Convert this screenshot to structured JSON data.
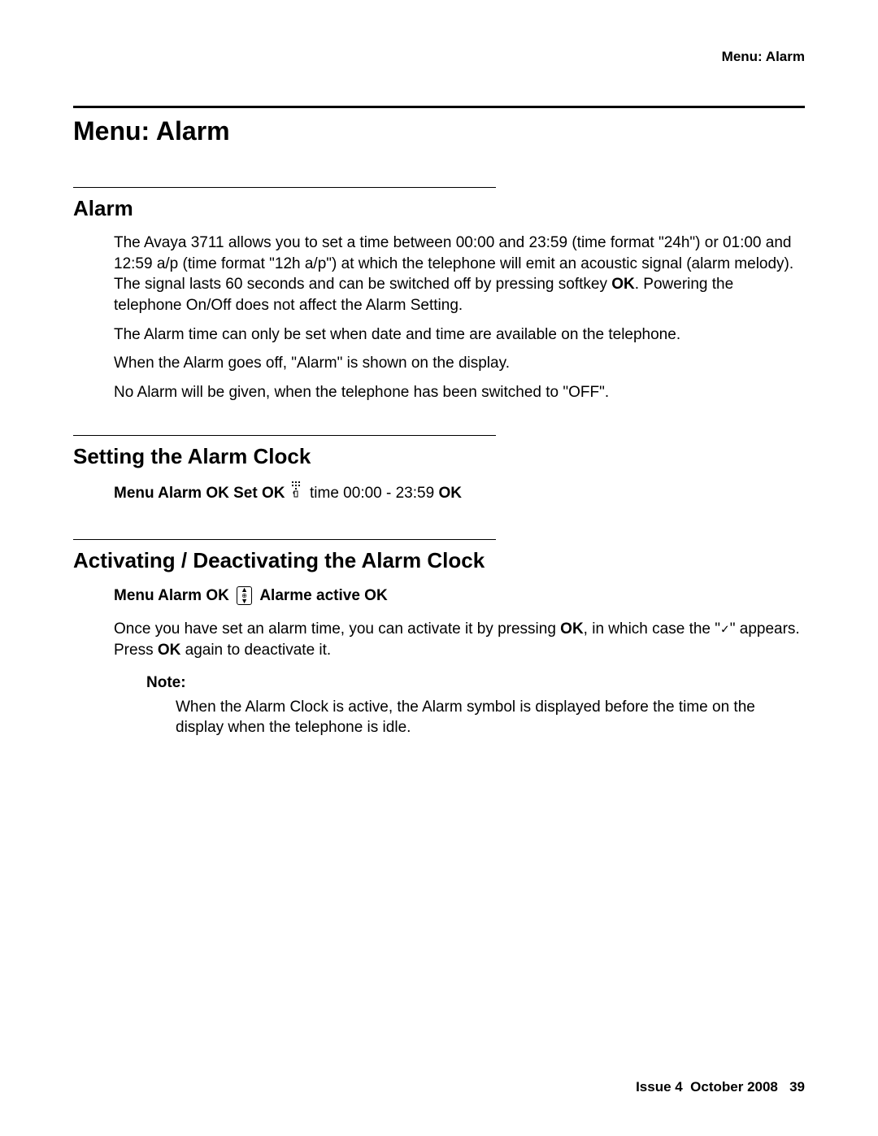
{
  "header": {
    "running": "Menu: Alarm"
  },
  "title": "Menu: Alarm",
  "sections": {
    "alarm": {
      "heading": "Alarm",
      "p1a": "The Avaya 3711 allows you to set a time between 00:00 and 23:59 (time format \"24h\") or 01:00 and 12:59 a/p (time format \"12h a/p\") at which the telephone will emit an acoustic signal (alarm melody). The signal lasts 60 seconds and can be switched off by pressing softkey ",
      "p1b": "OK",
      "p1c": ". Powering the telephone On/Off does not affect the Alarm Setting.",
      "p2": "The Alarm time can only be set when date and time are available on the telephone.",
      "p3": "When the Alarm goes off, \"Alarm\" is shown on the display.",
      "p4": "No Alarm will be given, when the telephone has been switched to \"OFF\"."
    },
    "setting": {
      "heading": "Setting the Alarm Clock",
      "nav_pre": "Menu Alarm OK Set OK",
      "nav_mid": " time 00:00 - 23:59 ",
      "nav_post": "OK"
    },
    "activating": {
      "heading": "Activating / Deactivating the Alarm Clock",
      "nav_pre": "Menu Alarm OK",
      "nav_post": "Alarme active OK",
      "p1a": "Once you have set an alarm time, you can activate it by pressing ",
      "p1b": "OK",
      "p1c": ", in which case the \"",
      "p1d": "\" appears. Press ",
      "p1e": "OK",
      "p1f": " again to deactivate it.",
      "note_label": "Note:",
      "note_text": "When the Alarm Clock is active, the Alarm symbol is displayed before the time on the display when the telephone is idle."
    }
  },
  "footer": {
    "issue_label": "Issue 4",
    "date": "October 2008",
    "page": "39"
  }
}
